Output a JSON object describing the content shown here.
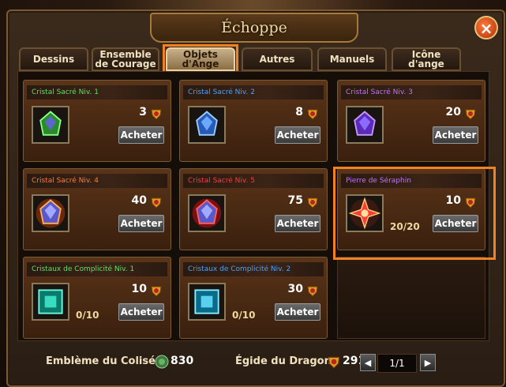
{
  "window": {
    "title": "Échoppe",
    "close_label": "×"
  },
  "tabs": [
    {
      "label": "Dessins",
      "active": false
    },
    {
      "label": "Ensemble de Courage",
      "active": false
    },
    {
      "label": "Objets d'Ange",
      "active": true
    },
    {
      "label": "Autres",
      "active": false
    },
    {
      "label": "Manuels",
      "active": false
    },
    {
      "label": "Icône d'ange",
      "active": false
    }
  ],
  "items": [
    {
      "name": "Cristal Sacré Niv. 1",
      "name_color": "#5fe05f",
      "price": "3",
      "buy_label": "Acheter",
      "count": "",
      "icon": "green-crystal-icon"
    },
    {
      "name": "Cristal Sacré Niv. 2",
      "name_color": "#4aa0ff",
      "price": "8",
      "buy_label": "Acheter",
      "count": "",
      "icon": "blue-crystal-icon"
    },
    {
      "name": "Cristal Sacré Niv. 3",
      "name_color": "#c070ff",
      "price": "20",
      "buy_label": "Acheter",
      "count": "",
      "icon": "purple-crystal-icon"
    },
    {
      "name": "Cristal Sacré Niv. 4",
      "name_color": "#ff7a3a",
      "price": "40",
      "buy_label": "Acheter",
      "count": "",
      "icon": "orange-crystal-icon"
    },
    {
      "name": "Cristal Sacré Niv. 5",
      "name_color": "#ff3a3a",
      "price": "75",
      "buy_label": "Acheter",
      "count": "",
      "icon": "red-crystal-icon"
    },
    {
      "name": "Pierre de Séraphin",
      "name_color": "#c070ff",
      "price": "10",
      "buy_label": "Acheter",
      "count": "20/20",
      "icon": "seraphin-stone-icon"
    },
    {
      "name": "Cristaux de Complicité Niv. 1",
      "name_color": "#5fe05f",
      "price": "10",
      "buy_label": "Acheter",
      "count": "0/10",
      "icon": "teal-square-gem-icon"
    },
    {
      "name": "Cristaux de Complicité Niv. 2",
      "name_color": "#4aa0ff",
      "price": "30",
      "buy_label": "Acheter",
      "count": "0/10",
      "icon": "cyan-square-gem-icon"
    }
  ],
  "footer": {
    "emblem_label": "Emblème du Colisée",
    "emblem_value": "830",
    "egide_label": "Égide du Dragon",
    "egide_value": "291",
    "page": "1/1"
  },
  "colors": {
    "highlight": "#f58220",
    "accent": "#f0d9a0"
  }
}
